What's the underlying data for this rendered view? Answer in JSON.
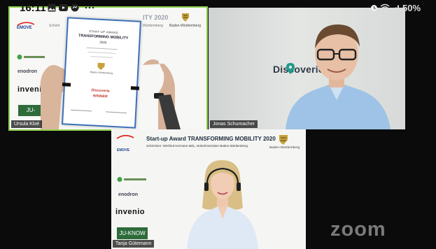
{
  "status_bar": {
    "time": "16:11",
    "left_icons": [
      "gallery-icon",
      "youtube-icon",
      "messenger-icon",
      "more-dots-icon"
    ],
    "right_icons": [
      "alarm-icon",
      "wifi-icon",
      "signal-icon"
    ],
    "battery": "50"
  },
  "tiles": {
    "tile1": {
      "name": "Ursula Kloé",
      "logos": {
        "emove": "EMOVE",
        "greenlogo": "",
        "enodron": "enodron",
        "invenio": "invenio",
        "juknow": "JU-KNOW"
      },
      "certificate": {
        "label": "START-UP AWARD",
        "title": "TRANSFORMING MOBILITY",
        "year": "2020",
        "state": "Baden-Württemberg",
        "company": "Discoverie",
        "award": "WINNER"
      },
      "banner_fragment": "ITY 2020",
      "banner_fragment_2": "Schirm",
      "banner_fragment_3": "Württemberg",
      "crest_label": "Baden-Württemberg"
    },
    "tile2": {
      "name": "Jonas Schumacher",
      "sign": "Discoverie"
    },
    "tile3": {
      "name": "Tanja Gütemann",
      "banner_title": "Start-up Award TRANSFORMING MOBILITY 2020",
      "banner_sub": "Schirmherr: Winfried Hermann MdL, Verkehrsminister Baden-Württemberg",
      "crest_label": "Baden-Württemberg",
      "logos": {
        "emove": "EMOVE",
        "enodron": "enodron",
        "invenio": "invenio",
        "juknow": "JU-KNOW"
      }
    }
  },
  "zoom_watermark": "zoom",
  "colors": {
    "active_speaker_border": "#8fd14f",
    "juknow_green": "#2e6b3a",
    "certificate_blue": "#3b6fb6"
  }
}
